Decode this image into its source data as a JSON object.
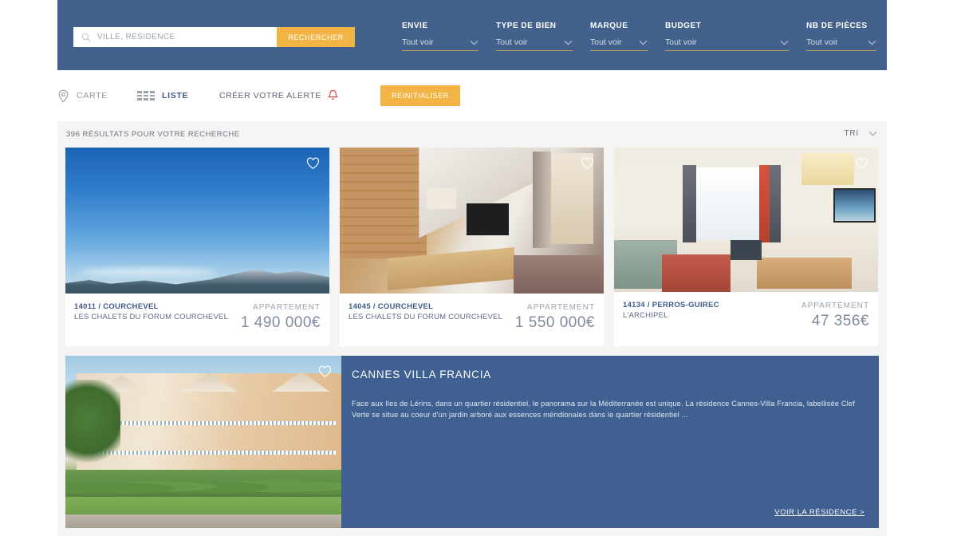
{
  "colors": {
    "header_bg": "#42618c",
    "accent_orange": "#f2b444",
    "panel_blue": "#3f6090",
    "results_bg": "#f4f4f5",
    "link_blue": "#3c5a87",
    "bell_red": "#e03a3a"
  },
  "search": {
    "placeholder": "VILLE, RÉSIDENCE",
    "value": "",
    "button_label": "RECHERCHER",
    "icon": "search-icon"
  },
  "filters": [
    {
      "label": "ENVIE",
      "value": "Tout voir",
      "icon": "chevron-down-icon"
    },
    {
      "label": "TYPE DE BIEN",
      "value": "Tout voir",
      "icon": "chevron-down-icon"
    },
    {
      "label": "MARQUE",
      "value": "Tout voir",
      "icon": "chevron-down-icon"
    },
    {
      "label": "BUDGET",
      "value": "Tout voir",
      "icon": "chevron-down-icon"
    },
    {
      "label": "NB DE PIÈCES",
      "value": "Tout voir",
      "icon": "chevron-down-icon"
    }
  ],
  "toolbar": {
    "carte_label": "CARTE",
    "carte_icon": "map-pin-icon",
    "liste_label": "LISTE",
    "liste_icon": "grid-icon",
    "alerte_label": "CRÉER VOTRE ALERTE",
    "alerte_icon": "bell-icon",
    "reset_label": "REINITIALISER"
  },
  "results": {
    "count_text": "396 RÉSULTATS POUR VOTRE RECHERCHE",
    "sort_label": "TRI",
    "sort_icon": "chevron-down-icon"
  },
  "cards": [
    {
      "ref": "14011 / COURCHEVEL",
      "residence": "LES CHALETS DU FORUM COURCHEVEL",
      "type": "APPARTEMENT",
      "price": "1 490 000€",
      "favorite_icon": "heart-icon"
    },
    {
      "ref": "14045 / COURCHEVEL",
      "residence": "LES CHALETS DU FORUM COURCHEVEL",
      "type": "APPARTEMENT",
      "price": "1 550 000€",
      "favorite_icon": "heart-icon"
    },
    {
      "ref": "14134 / PERROS-GUIREC",
      "residence": "L'ARCHIPEL",
      "type": "APPARTEMENT",
      "price": "47 356€",
      "favorite_icon": "heart-icon"
    }
  ],
  "featured": {
    "title": "CANNES VILLA FRANCIA",
    "description": "Face aux Iles de Lérins, dans un quartier résidentiel, le panorama sur la Méditerranée est unique. La résidence Cannes-Villa Francia, labellisée Clef Verte se situe au coeur d'un jardin arboré aux essences méridionales dans le quartier résidentiel ...",
    "link_label": "VOIR LA RÉSIDENCE >",
    "favorite_icon": "heart-icon"
  }
}
